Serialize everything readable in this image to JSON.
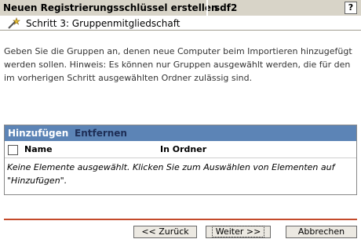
{
  "header": {
    "title": "Neuen Registrierungsschlüssel erstellen",
    "name_value": "sdf2",
    "help_label": "?"
  },
  "step": {
    "icon": "wizard-wand-icon",
    "label": "Schritt 3: Gruppenmitgliedschaft"
  },
  "description": "Geben Sie die Gruppen an, denen neue Computer beim Importieren hinzugefügt werden sollen. Hinweis: Es können nur Gruppen ausgewählt werden, die für den im vorherigen Schritt ausgewählten Ordner zulässig sind.",
  "panel": {
    "add_label": "Hinzufügen",
    "remove_label": "Entfernen",
    "columns": [
      "Name",
      "In Ordner"
    ],
    "empty_text": "Keine Elemente ausgewählt. Klicken Sie zum Auswählen von Elementen auf \"Hinzufügen\"."
  },
  "footer": {
    "back_label": "<< Zurück",
    "next_label": "Weiter >>",
    "cancel_label": "Abbrechen"
  },
  "colors": {
    "toolbar_bg": "#5c84b6",
    "titlebar_bg": "#d8d4c8",
    "divider": "#c44a2a"
  }
}
